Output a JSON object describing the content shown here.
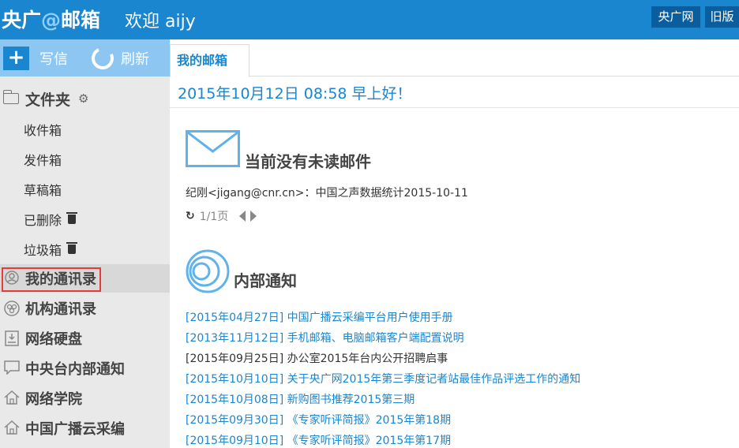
{
  "header": {
    "brand_prefix": "央广",
    "brand_at": "@",
    "brand_suffix": "邮箱",
    "welcome": "欢迎 aijy",
    "link_cnr": "央广网",
    "link_old": "旧版"
  },
  "toolbar": {
    "write_label": "写信",
    "refresh_label": "刷新"
  },
  "sidebar": {
    "folder_title": "文件夹",
    "folders": [
      {
        "label": "收件箱",
        "icon": "none"
      },
      {
        "label": "发件箱",
        "icon": "none"
      },
      {
        "label": "草稿箱",
        "icon": "none"
      },
      {
        "label": "已删除",
        "icon": "trash-icon"
      },
      {
        "label": "垃圾箱",
        "icon": "trash-icon"
      }
    ],
    "nav": [
      {
        "label": "我的通讯录",
        "icon": "person-icon",
        "active": true
      },
      {
        "label": "机构通讯录",
        "icon": "org-icon"
      },
      {
        "label": "网络硬盘",
        "icon": "disk-icon"
      },
      {
        "label": "中央台内部通知",
        "icon": "chat-icon"
      },
      {
        "label": "网络学院",
        "icon": "house-icon"
      },
      {
        "label": "中国广播云采编",
        "icon": "house-icon"
      }
    ]
  },
  "tabs": [
    {
      "label": "我的邮箱",
      "active": true
    }
  ],
  "main": {
    "greeting": "2015年10月12日 08:58   早上好！",
    "unread_title": "当前没有未读邮件",
    "mail_line": "纪刚<jigang@cnr.cn>：中国之声数据统计2015-10-11",
    "pager_text": "1/1页",
    "notice_title": "内部通知",
    "notices": [
      {
        "text": "[2015年04月27日] 中国广播云采编平台用户使用手册",
        "color": "#1a86d0"
      },
      {
        "text": "[2013年11月12日] 手机邮箱、电脑邮箱客户端配置说明",
        "color": "#1a86d0"
      },
      {
        "text": "[2015年09月25日] 办公室2015年台内公开招聘启事",
        "color": "#333333"
      },
      {
        "text": "[2015年10月10日] 关于央广网2015年第三季度记者站最佳作品评选工作的通知",
        "color": "#1a86d0"
      },
      {
        "text": "[2015年10月08日] 新购图书推荐2015第三期",
        "color": "#1a86d0"
      },
      {
        "text": "[2015年09月30日] 《专家听评简报》2015年第18期",
        "color": "#1a86d0"
      },
      {
        "text": "[2015年09月10日] 《专家听评简报》2015年第17期",
        "color": "#1a86d0"
      }
    ]
  },
  "colors": {
    "brand_blue": "#1a86d0",
    "toolbar_blue": "#8cc6f1",
    "highlight_red": "#e33c3c"
  }
}
